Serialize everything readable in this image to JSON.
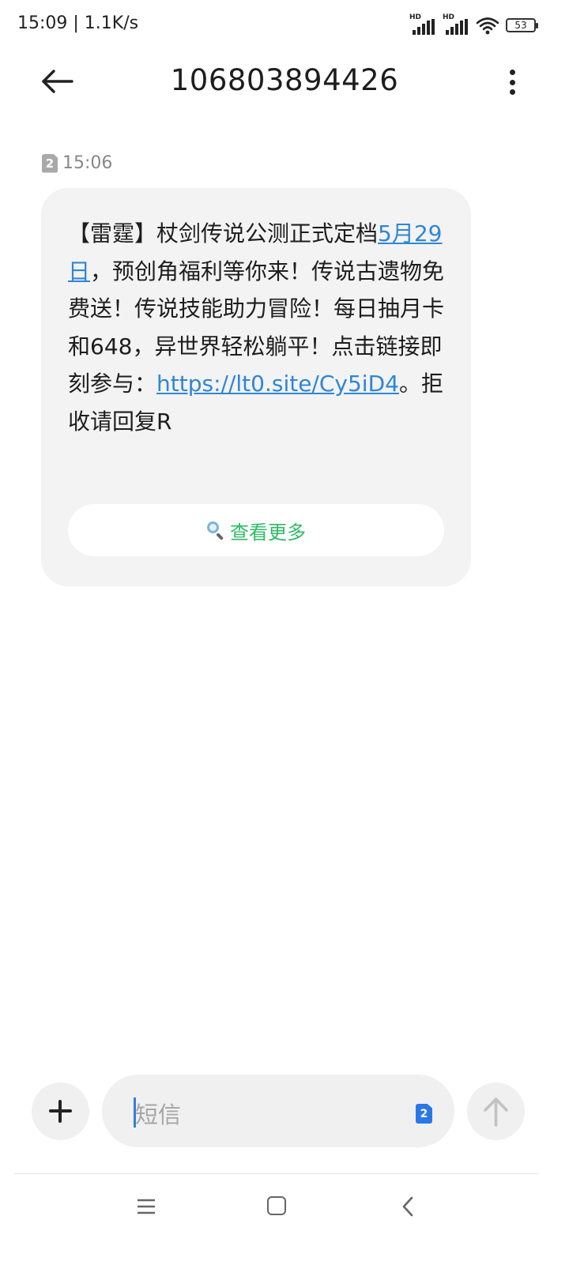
{
  "status_bar": {
    "time_speed": "15:09 | 1.1K/s",
    "signal1_label": "HD",
    "signal2_label": "HD",
    "battery": "53"
  },
  "header": {
    "title": "106803894426"
  },
  "message": {
    "sim_number": "2",
    "time": "15:06",
    "text_part1": "【雷霆】杖剑传说公测正式定档",
    "date_link": "5月29日",
    "text_part2": "，预创角福利等你来！传说古遗物免费送！传说技能助力冒险！每日抽月卡和648，异世界轻松躺平！点击链接即刻参与：",
    "url_link": "https://lt0.site/Cy5iD4",
    "text_part3": "。拒收请回复R",
    "view_more_label": "查看更多"
  },
  "input_bar": {
    "placeholder": "短信",
    "sim_number": "2"
  },
  "icons": {
    "back": "arrow-left-icon",
    "more": "more-vertical-icon",
    "plus": "plus-icon",
    "send": "arrow-up-icon",
    "view_more": "magnifier-icon"
  },
  "colors": {
    "link": "#2f86d6",
    "view_more": "#2dbb63",
    "sim_badge_active": "#2a78e4",
    "bubble": "#f3f3f3"
  }
}
